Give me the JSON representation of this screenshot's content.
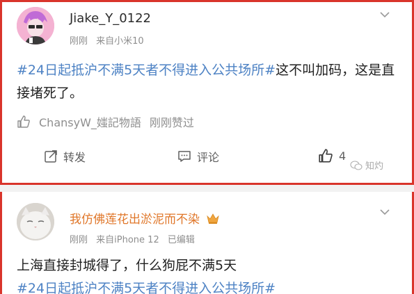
{
  "posts": [
    {
      "username": "Jiake_Y_0122",
      "time": "刚刚",
      "source": "来自小米10",
      "hashtag": "#24日起抵沪不满5天者不得进入公共场所#",
      "text": "这不叫加码，这是直接堵死了。",
      "liked_by": "ChansyW_媸記物語",
      "liked_status": "刚刚赞过",
      "share_label": "转发",
      "comment_label": "评论",
      "like_count": "4"
    },
    {
      "username": "我仿佛莲花出淤泥而不染",
      "time": "刚刚",
      "source": "来自iPhone 12",
      "edited": "已编辑",
      "text": "上海直接封城得了，什么狗屁不满5天",
      "hashtag": "#24日起抵沪不满5天者不得进入公共场所#"
    }
  ],
  "watermark": "知灼",
  "colors": {
    "hashtag": "#4d82c4",
    "frame": "#d9342b",
    "vip_name": "#e0772a"
  }
}
